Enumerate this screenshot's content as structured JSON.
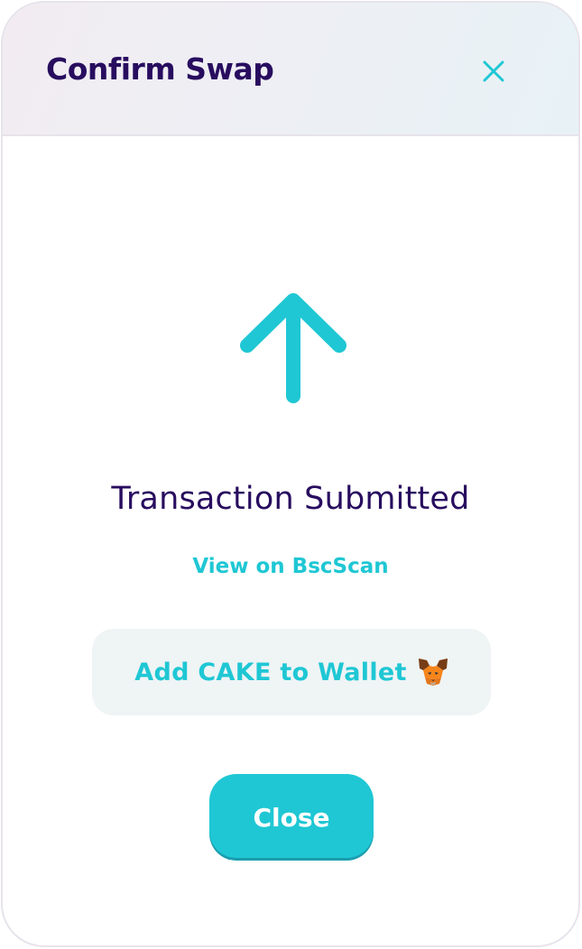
{
  "modal": {
    "title": "Confirm Swap",
    "status_text": "Transaction Submitted",
    "explorer_link": "View on BscScan",
    "add_token_label": "Add CAKE to Wallet",
    "close_label": "Close"
  },
  "icons": {
    "header_close": "close-icon",
    "status": "arrow-up-icon",
    "wallet": "metamask-fox-icon"
  },
  "colors": {
    "primary": "#1fc7d4",
    "text": "#280d5f",
    "header_bg_start": "#f2ecf2",
    "header_bg_end": "#e8f2f6",
    "tertiary_bg": "#eff4f5"
  }
}
